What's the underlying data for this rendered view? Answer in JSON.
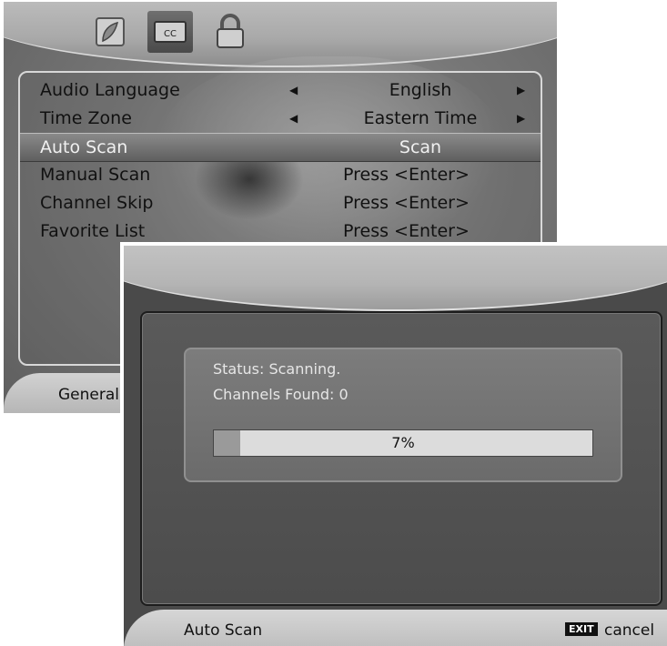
{
  "back_menu": {
    "tabs": [
      {
        "icon": "picture-icon"
      },
      {
        "icon": "cc-icon",
        "label": "CC"
      },
      {
        "icon": "lock-icon"
      }
    ],
    "rows": [
      {
        "label": "Audio Language",
        "value": "English",
        "arrows": true
      },
      {
        "label": "Time Zone",
        "value": "Eastern Time",
        "arrows": true
      },
      {
        "label": "Auto Scan",
        "value": "Scan",
        "selected": true
      },
      {
        "label": "Manual Scan",
        "value": "Press <Enter>"
      },
      {
        "label": "Channel Skip",
        "value": "Press <Enter>"
      },
      {
        "label": "Favorite List",
        "value": "Press <Enter>"
      }
    ],
    "footer_label": "General"
  },
  "scan_dialog": {
    "status_text": "Status: Scanning.",
    "channels_text": "Channels Found: 0",
    "progress": 7,
    "progress_label": "7%",
    "footer_title": "Auto Scan",
    "exit_key": "EXIT",
    "cancel_label": "cancel"
  },
  "colors": {
    "panel_dark": "#4a4a4a",
    "progress_track": "#dcdcdc",
    "progress_fill": "#9a9a9a"
  }
}
